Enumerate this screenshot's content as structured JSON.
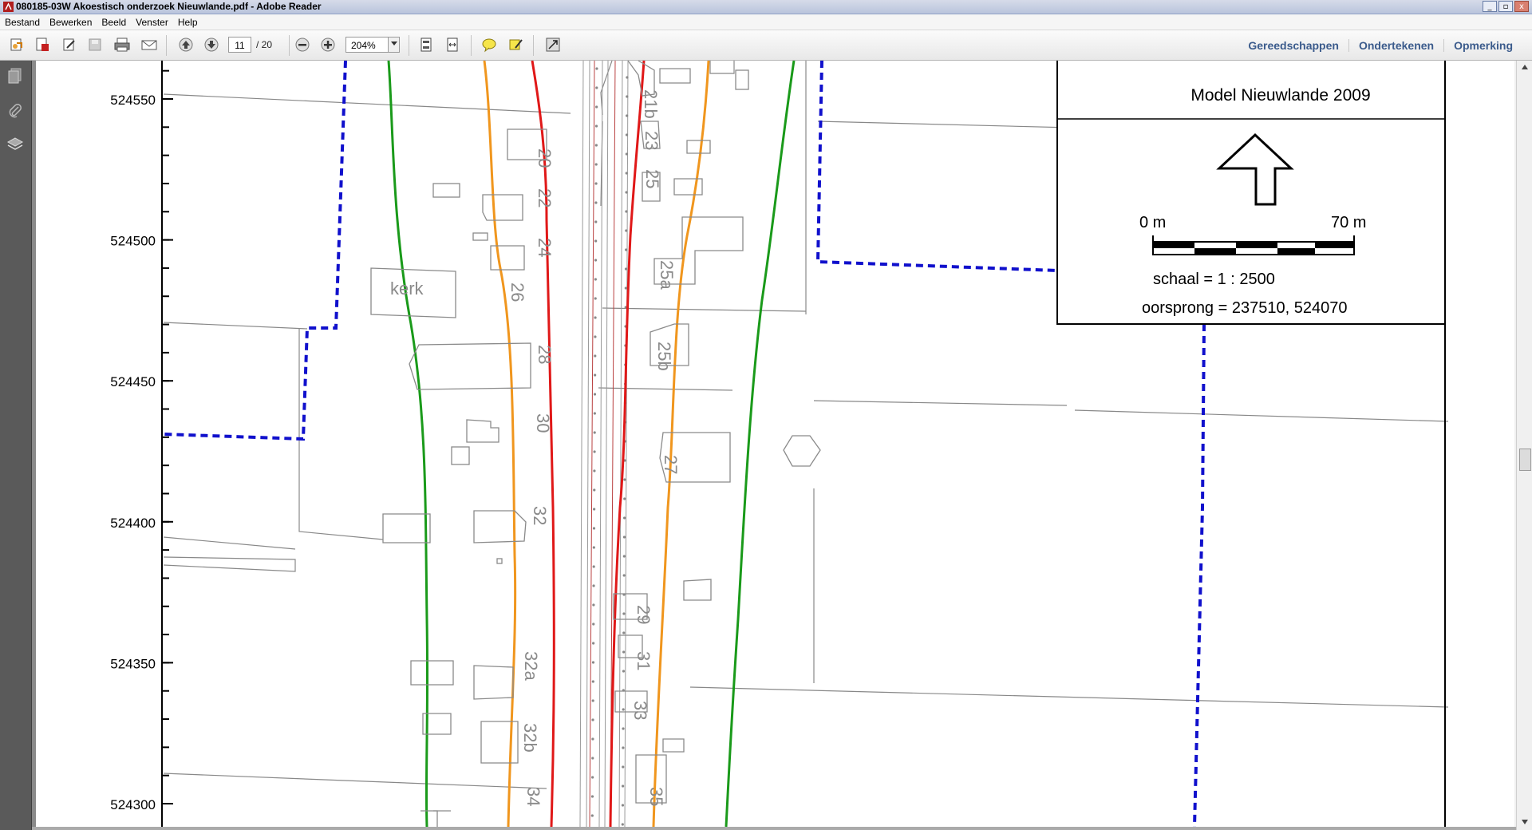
{
  "window": {
    "title": "080185-03W Akoestisch onderzoek Nieuwlande.pdf - Adobe Reader",
    "controls": [
      "_",
      "▫",
      "x"
    ]
  },
  "menu": [
    "Bestand",
    "Bewerken",
    "Beeld",
    "Venster",
    "Help"
  ],
  "toolbar": {
    "page_current": "11",
    "page_total": "/ 20",
    "zoom": "204%",
    "links": [
      "Gereedschappen",
      "Ondertekenen",
      "Opmerking"
    ]
  },
  "map": {
    "y_axis": {
      "ticks": [
        "524550",
        "524500",
        "524450",
        "524400",
        "524350",
        "524300"
      ]
    },
    "legend": {
      "title": "Model Nieuwlande 2009",
      "scale_start": "0 m",
      "scale_end": "70 m",
      "scale_text": "schaal = 1 : 2500",
      "origin_text": "oorsprong = 237510, 524070"
    },
    "labels": {
      "kerk": "kerk",
      "h20": "20",
      "h22": "22",
      "h24": "24",
      "h26": "26",
      "h28": "28",
      "h30": "30",
      "h32": "32",
      "h32a": "32a",
      "h32b": "32b",
      "h34": "34",
      "h21b": "21b",
      "h23": "23",
      "h25": "25",
      "h25a": "25a",
      "h25b": "25b",
      "h27": "27",
      "h29": "29",
      "h31": "31",
      "h33": "33",
      "h35": "35"
    },
    "colors": {
      "green": "#1a9a1a",
      "orange": "#f0961e",
      "red": "#e01818",
      "blue_dashed": "#1010cc",
      "building": "#8a8a8a"
    }
  },
  "icons": {
    "sidebar": [
      "pages-icon",
      "attachment-icon",
      "layers-icon"
    ]
  }
}
